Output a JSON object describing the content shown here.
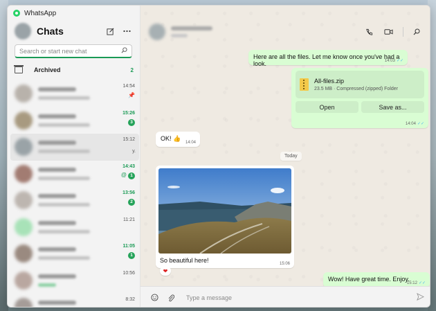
{
  "app": {
    "title": "WhatsApp"
  },
  "window_controls": {
    "minimize": "—",
    "maximize": "☐",
    "close": "✕"
  },
  "sidebar": {
    "title": "Chats",
    "search_placeholder": "Search or start new chat",
    "archived": {
      "label": "Archived",
      "count": "2"
    },
    "chats": [
      {
        "time": "14:54",
        "pinned": true,
        "unread": "",
        "active": false,
        "avatar_color": "#b8b2ab"
      },
      {
        "time": "15:26",
        "pinned": false,
        "unread": "3",
        "active": false,
        "avatar_color": "#a89a80"
      },
      {
        "time": "15:12",
        "pinned": false,
        "unread": "",
        "active": true,
        "trail": "y.",
        "avatar_color": "#9aa3a7"
      },
      {
        "time": "14:43",
        "pinned": false,
        "unread": "1",
        "mention": true,
        "active": false,
        "avatar_color": "#a27c72"
      },
      {
        "time": "13:56",
        "pinned": false,
        "unread": "2",
        "active": false,
        "avatar_color": "#bdb6b0"
      },
      {
        "time": "11:21",
        "pinned": false,
        "unread": "",
        "active": false,
        "avatar_color": "#a8e2b8"
      },
      {
        "time": "11:05",
        "pinned": false,
        "unread": "1",
        "active": false,
        "avatar_color": "#9a8a80"
      },
      {
        "time": "10:56",
        "pinned": false,
        "unread": "",
        "green_preview": true,
        "active": false,
        "avatar_color": "#b9a7a0"
      },
      {
        "time": "8:32",
        "pinned": false,
        "unread": "",
        "active": false,
        "avatar_color": "#a59c98"
      }
    ]
  },
  "conversation": {
    "messages": {
      "m1": {
        "text": "Here are all the files. Let me know once you've had a look.",
        "time": "14:03"
      },
      "file": {
        "name": "All-files.zip",
        "info": "23.5 MB · Compressed (zipped) Folder",
        "open": "Open",
        "save_as": "Save as...",
        "time": "14:04"
      },
      "m2": {
        "text": "OK! 👍",
        "time": "14:04"
      },
      "divider": "Today",
      "photo": {
        "caption": "So beautiful here!",
        "time": "15:06",
        "reaction": "❤"
      },
      "m3": {
        "text": "Wow! Have great time. Enjoy.",
        "time": "15:12"
      }
    }
  },
  "composer": {
    "placeholder": "Type a message"
  },
  "colors": {
    "accent": "#25d366",
    "outgoing": "#d9fdd3",
    "unread": "#1a9a55"
  }
}
